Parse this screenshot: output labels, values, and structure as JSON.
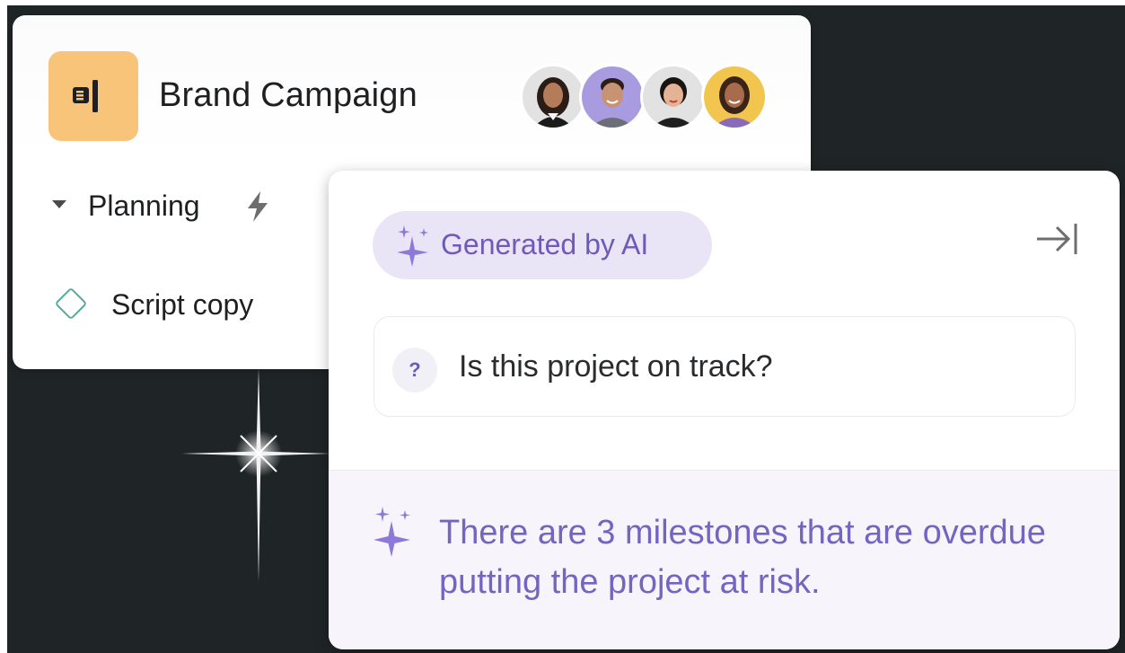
{
  "project": {
    "title": "Brand Campaign",
    "icon": "megaphone-icon",
    "icon_bg": "#f7c47a",
    "members": [
      {
        "name": "avatar-1",
        "bg": "#e2e2e2"
      },
      {
        "name": "avatar-2",
        "bg": "#a99be0"
      },
      {
        "name": "avatar-3",
        "bg": "#e2e2e2"
      },
      {
        "name": "avatar-4",
        "bg": "#f2c64e"
      }
    ]
  },
  "section": {
    "label": "Planning",
    "icon": "lightning-icon"
  },
  "task": {
    "label": "Script copy",
    "icon": "milestone-diamond-icon"
  },
  "ai_panel": {
    "chip_label": "Generated by AI",
    "chip_icon": "sparkles-icon",
    "collapse_icon": "collapse-right-icon",
    "question_badge": "?",
    "question": "Is this project on track?",
    "answer": "There are 3 milestones that are overdue putting the project at risk.",
    "accent": "#6e5ab8"
  }
}
